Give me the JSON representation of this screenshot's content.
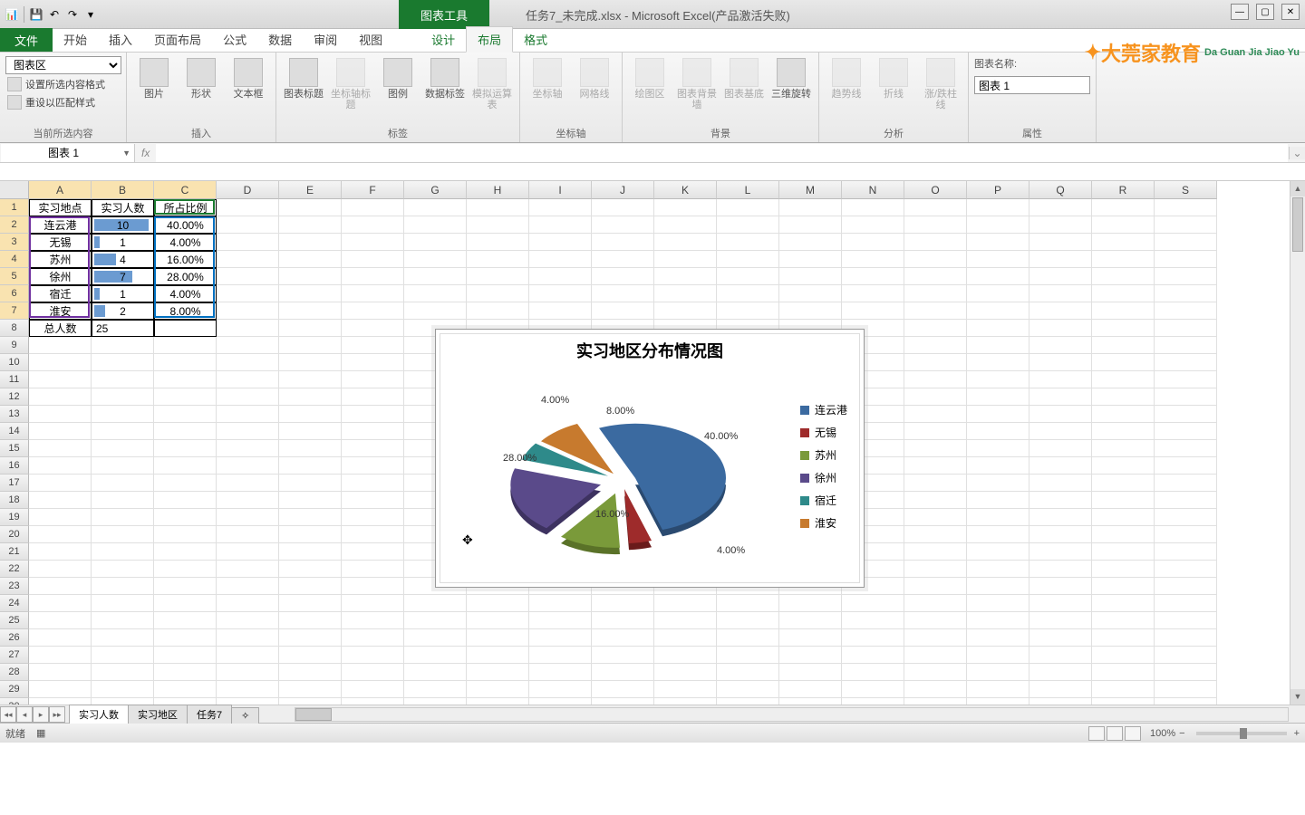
{
  "titlebar": {
    "context_tool": "图表工具",
    "filename": "任务7_未完成.xlsx - Microsoft Excel(产品激活失败)"
  },
  "tabs": {
    "file": "文件",
    "items": [
      "开始",
      "插入",
      "页面布局",
      "公式",
      "数据",
      "审阅",
      "视图"
    ],
    "context": [
      "设计",
      "布局",
      "格式"
    ],
    "active": "布局"
  },
  "ribbon": {
    "selection": {
      "label": "当前所选内容",
      "dropdown": "图表区",
      "fmt_sel": "设置所选内容格式",
      "reset": "重设以匹配样式"
    },
    "insert": {
      "label": "插入",
      "pic": "图片",
      "shape": "形状",
      "textbox": "文本框"
    },
    "labels": {
      "label": "标签",
      "title": "图表标题",
      "axis_title": "坐标轴标题",
      "legend": "图例",
      "data_labels": "数据标签",
      "sim": "模拟运算表"
    },
    "axes": {
      "label": "坐标轴",
      "axis": "坐标轴",
      "grid": "网格线"
    },
    "bg": {
      "label": "背景",
      "plot": "绘图区",
      "wall": "图表背景墙",
      "floor": "图表基底",
      "rot3d": "三维旋转"
    },
    "analysis": {
      "label": "分析",
      "trend": "趋势线",
      "line": "折线",
      "updown": "涨/跌柱线"
    },
    "props": {
      "label": "属性",
      "name_label": "图表名称:",
      "name_value": "图表 1"
    }
  },
  "logo": {
    "main": "大莞家教育",
    "sub": "Da Guan Jia Jiao Yu"
  },
  "namebox": "图表 1",
  "columns": [
    "A",
    "B",
    "C",
    "D",
    "E",
    "F",
    "G",
    "H",
    "I",
    "J",
    "K",
    "L",
    "M",
    "N",
    "O",
    "P",
    "Q",
    "R",
    "S"
  ],
  "table": {
    "headers": [
      "实习地点",
      "实习人数",
      "所占比例"
    ],
    "rows": [
      [
        "连云港",
        "10",
        "40.00%"
      ],
      [
        "无锡",
        "1",
        "4.00%"
      ],
      [
        "苏州",
        "4",
        "16.00%"
      ],
      [
        "徐州",
        "7",
        "28.00%"
      ],
      [
        "宿迁",
        "1",
        "4.00%"
      ],
      [
        "淮安",
        "2",
        "8.00%"
      ]
    ],
    "total": [
      "总人数",
      "25",
      ""
    ]
  },
  "chart_data": {
    "type": "pie",
    "title": "实习地区分布情况图",
    "categories": [
      "连云港",
      "无锡",
      "苏州",
      "徐州",
      "宿迁",
      "淮安"
    ],
    "values": [
      40.0,
      4.0,
      16.0,
      28.0,
      4.0,
      8.0
    ],
    "labels": [
      "40.00%",
      "4.00%",
      "16.00%",
      "28.00%",
      "4.00%",
      "8.00%"
    ],
    "colors": [
      "#3b6aa0",
      "#9e2b2b",
      "#7a9a3a",
      "#5a4a8a",
      "#2e8a8a",
      "#c77a2e"
    ]
  },
  "sheets": {
    "items": [
      "实习人数",
      "实习地区",
      "任务7"
    ],
    "active": 0
  },
  "status": {
    "ready": "就绪",
    "zoom": "100%"
  }
}
